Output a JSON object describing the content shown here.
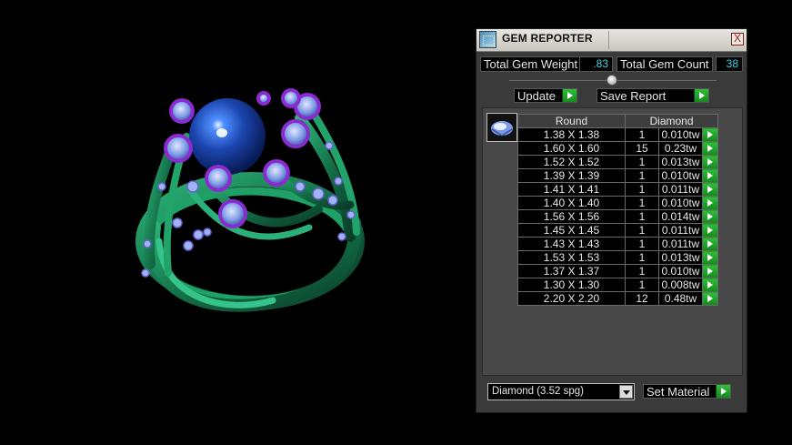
{
  "panel": {
    "title": "GEM REPORTER",
    "close": "X",
    "total_weight_label": "Total Gem Weight",
    "total_weight_value": ".83",
    "total_count_label": "Total Gem Count",
    "total_count_value": "38",
    "update_label": "Update",
    "save_report_label": "Save Report",
    "table": {
      "shape_header": "Round",
      "material_header": "Diamond",
      "rows": [
        {
          "size": "1.38 X 1.38",
          "count": "1",
          "weight": "0.010tw"
        },
        {
          "size": "1.60 X 1.60",
          "count": "15",
          "weight": "0.23tw"
        },
        {
          "size": "1.52 X 1.52",
          "count": "1",
          "weight": "0.013tw"
        },
        {
          "size": "1.39 X 1.39",
          "count": "1",
          "weight": "0.010tw"
        },
        {
          "size": "1.41 X 1.41",
          "count": "1",
          "weight": "0.011tw"
        },
        {
          "size": "1.40 X 1.40",
          "count": "1",
          "weight": "0.010tw"
        },
        {
          "size": "1.56 X 1.56",
          "count": "1",
          "weight": "0.014tw"
        },
        {
          "size": "1.45 X 1.45",
          "count": "1",
          "weight": "0.011tw"
        },
        {
          "size": "1.43 X 1.43",
          "count": "1",
          "weight": "0.011tw"
        },
        {
          "size": "1.53 X 1.53",
          "count": "1",
          "weight": "0.013tw"
        },
        {
          "size": "1.37 X 1.37",
          "count": "1",
          "weight": "0.010tw"
        },
        {
          "size": "1.30 X 1.30",
          "count": "1",
          "weight": "0.008tw"
        },
        {
          "size": "2.20 X 2.20",
          "count": "12",
          "weight": "0.48tw"
        }
      ]
    },
    "material_select": "Diamond    (3.52 spg)",
    "set_material_label": "Set Material"
  },
  "colors": {
    "value_text": "#3ad1e8",
    "go_arrow": "#22a82c",
    "ring_metal": "#1f8a5c",
    "center_stone": "#1e4fb5",
    "prong_accent": "#8a2bd0"
  }
}
